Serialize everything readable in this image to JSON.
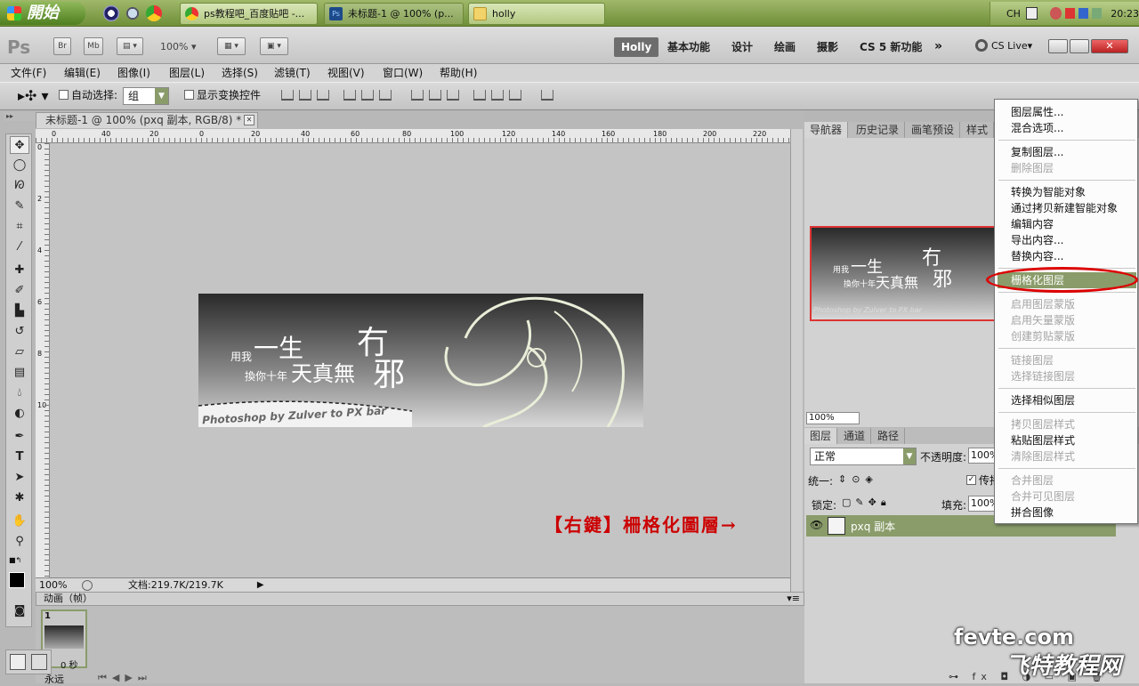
{
  "taskbar": {
    "start_label": "開始",
    "tasks": [
      "ps教程吧_百度贴吧 -...",
      "未标题-1 @ 100% (p...",
      "holly"
    ],
    "tray_lang": "CH",
    "tray_time": "20:23"
  },
  "appbar": {
    "zoom": "100%",
    "workspaces": [
      "Holly",
      "基本功能",
      "设计",
      "绘画",
      "摄影",
      "CS 5 新功能"
    ],
    "cslive": "CS Live"
  },
  "menubar": [
    "文件(F)",
    "编辑(E)",
    "图像(I)",
    "图层(L)",
    "选择(S)",
    "滤镜(T)",
    "视图(V)",
    "窗口(W)",
    "帮助(H)"
  ],
  "options": {
    "auto_select_label": "自动选择:",
    "auto_select_value": "组",
    "show_transform_label": "显示变换控件"
  },
  "document": {
    "tab_title": "未标题-1 @ 100% (pxq 副本, RGB/8) *",
    "ruler_h": [
      "0",
      "40",
      "20",
      "0",
      "20",
      "40",
      "60",
      "80",
      "100",
      "120",
      "140",
      "160",
      "180",
      "200",
      "220"
    ],
    "ruler_v": [
      "0",
      "2",
      "4",
      "6",
      "8",
      "10"
    ],
    "zoom": "100%",
    "doc_size": "文档:219.7K/219.7K",
    "art_line1": "用我",
    "art_line2": "換你十年",
    "art_big1": "一生",
    "art_big2": "天真無",
    "art_big3": "邪",
    "art_big4": "冇",
    "art_banner": "Photoshop by Zulver to PX bar"
  },
  "animation": {
    "title": "动画（帧）",
    "frame_number": "1",
    "frame_delay": "0 秒",
    "loop": "永远"
  },
  "nav_panel": {
    "tabs": [
      "导航器",
      "历史记录",
      "画笔预设",
      "样式"
    ],
    "zoom": "100%"
  },
  "layers_panel": {
    "tabs": [
      "图层",
      "通道",
      "路径"
    ],
    "blend_mode": "正常",
    "opacity_label": "不透明度:",
    "opacity_value": "100%",
    "unify_label": "统一:",
    "propagate_label": "传播",
    "lock_label": "锁定:",
    "fill_label": "填充:",
    "fill_value": "100%",
    "layer_name": "pxq 副本"
  },
  "context_menu": {
    "items": [
      {
        "label": "图层属性...",
        "enabled": true
      },
      {
        "label": "混合选项...",
        "enabled": true
      },
      {
        "label": "复制图层...",
        "enabled": true
      },
      {
        "label": "删除图层",
        "enabled": false
      },
      {
        "label": "转换为智能对象",
        "enabled": true
      },
      {
        "label": "通过拷贝新建智能对象",
        "enabled": true
      },
      {
        "label": "编辑内容",
        "enabled": true
      },
      {
        "label": "导出内容...",
        "enabled": true
      },
      {
        "label": "替换内容...",
        "enabled": true
      },
      {
        "label": "栅格化图层",
        "enabled": true,
        "highlighted": true
      },
      {
        "label": "启用图层蒙版",
        "enabled": false
      },
      {
        "label": "启用矢量蒙版",
        "enabled": false
      },
      {
        "label": "创建剪贴蒙版",
        "enabled": false
      },
      {
        "label": "链接图层",
        "enabled": false
      },
      {
        "label": "选择链接图层",
        "enabled": false
      },
      {
        "label": "选择相似图层",
        "enabled": true
      },
      {
        "label": "拷贝图层样式",
        "enabled": false
      },
      {
        "label": "粘贴图层样式",
        "enabled": true
      },
      {
        "label": "清除图层样式",
        "enabled": false
      },
      {
        "label": "合并图层",
        "enabled": false
      },
      {
        "label": "合并可见图层",
        "enabled": false
      },
      {
        "label": "拼合图像",
        "enabled": true
      }
    ]
  },
  "annotation": "【右鍵】柵格化圖層→",
  "watermark": {
    "site": "fevte.com",
    "name": "飞特教程网"
  },
  "colors": {
    "highlight": "#8a9c6a",
    "annotation_red": "#cc0000"
  }
}
